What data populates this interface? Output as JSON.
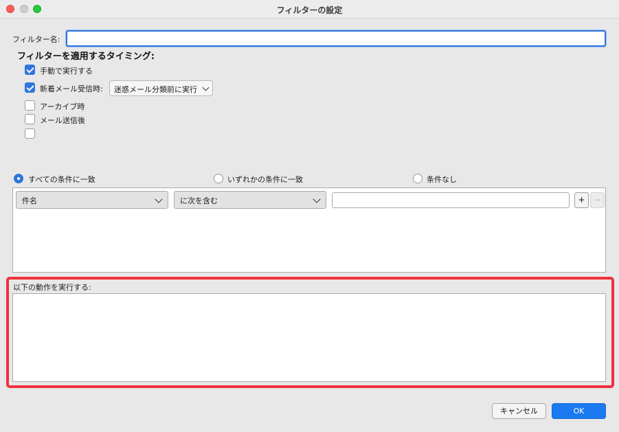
{
  "window": {
    "title": "フィルターの設定"
  },
  "filter_name": {
    "label": "フィルター名:",
    "value": ""
  },
  "timing": {
    "title": "フィルターを適用するタイミング:",
    "options": [
      {
        "label": "手動で実行する",
        "checked": true
      },
      {
        "label": "新着メール受信時:",
        "checked": true
      },
      {
        "label": "アーカイブ時",
        "checked": false
      },
      {
        "label": "メール送信後",
        "checked": false
      },
      {
        "label": "",
        "checked": false
      }
    ],
    "new_mail_select": "迷惑メール分類前に実行"
  },
  "match": {
    "options": [
      {
        "label": "すべての条件に一致",
        "selected": true
      },
      {
        "label": "いずれかの条件に一致",
        "selected": false
      },
      {
        "label": "条件なし",
        "selected": false
      }
    ]
  },
  "condition": {
    "field": "件名",
    "operator": "に次を含む",
    "value": "",
    "add": "+",
    "remove": "−"
  },
  "actions": {
    "label": "以下の動作を実行する:"
  },
  "buttons": {
    "cancel": "キャンセル",
    "ok": "OK"
  },
  "colors": {
    "accent": "#2f76dc",
    "highlight": "#f0303f",
    "ok_button": "#1b7af0"
  }
}
